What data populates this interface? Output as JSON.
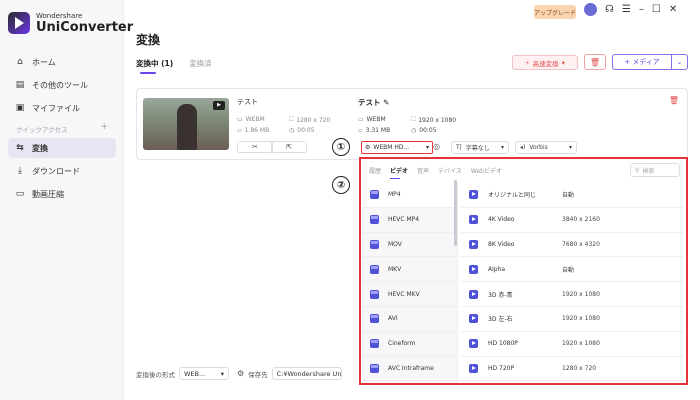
{
  "app": {
    "brand": "Wondershare",
    "product": "UniConverter"
  },
  "topbar": {
    "upgrade_label": "アップグレード"
  },
  "sidebar": {
    "items_top": [
      {
        "label": "ホーム",
        "icon": "home-icon"
      },
      {
        "label": "その他のツール",
        "icon": "toolbox-icon"
      },
      {
        "label": "マイファイル",
        "icon": "file-icon"
      }
    ],
    "section_label": "クイックアクセス",
    "section_add": "+",
    "items_bottom": [
      {
        "label": "変換",
        "icon": "convert-icon",
        "active": true
      },
      {
        "label": "ダウンロード",
        "icon": "download-icon"
      },
      {
        "label": "動画圧縮",
        "icon": "compress-icon"
      }
    ]
  },
  "main": {
    "title": "変換",
    "tabs": [
      {
        "label": "変換中 (1)",
        "active": true
      },
      {
        "label": "変換済"
      }
    ],
    "speed_label": "高速変換",
    "media_label": "+ メディア"
  },
  "file": {
    "source": {
      "name": "テスト",
      "format": "WEBM",
      "resolution": "1280 x 720",
      "size": "1.86 MB",
      "duration": "00:05"
    },
    "dest": {
      "name": "テスト",
      "format": "WEBM",
      "resolution": "1920 x 1080",
      "size": "3.31 MB",
      "duration": "00:05"
    },
    "format_select": "WEBM HD...",
    "subtitle_select": "字幕なし",
    "audio_select": "Vorbis"
  },
  "callouts": [
    "①",
    "②"
  ],
  "panel": {
    "tabs": [
      {
        "label": "履歴"
      },
      {
        "label": "ビデオ",
        "active": true
      },
      {
        "label": "音声"
      },
      {
        "label": "デバイス"
      },
      {
        "label": "Webビデオ"
      }
    ],
    "search_placeholder": "検索",
    "formats": [
      "MP4",
      "HEVC MP4",
      "MOV",
      "MKV",
      "HEVC MKV",
      "AVI",
      "Cineform",
      "AVC Intraframe"
    ],
    "resolutions": [
      {
        "name": "オリジナルと同じ",
        "value": "自動"
      },
      {
        "name": "4K Video",
        "value": "3840 x 2160"
      },
      {
        "name": "8K Video",
        "value": "7680 x 4320"
      },
      {
        "name": "Alpha",
        "value": "自動"
      },
      {
        "name": "3D 赤-青",
        "value": "1920 x 1080"
      },
      {
        "name": "3D 左-右",
        "value": "1920 x 1080"
      },
      {
        "name": "HD 1080P",
        "value": "1920 x 1080"
      },
      {
        "name": "HD 720P",
        "value": "1280 x 720"
      }
    ]
  },
  "bottom": {
    "format_label": "変換後の形式",
    "format_value": "WEB...",
    "save_label": "保存先",
    "save_path": "C:¥Wondershare UniC"
  },
  "colors": {
    "accent": "#6b45e8",
    "highlight": "#e8323a",
    "danger": "#e04a4a"
  }
}
